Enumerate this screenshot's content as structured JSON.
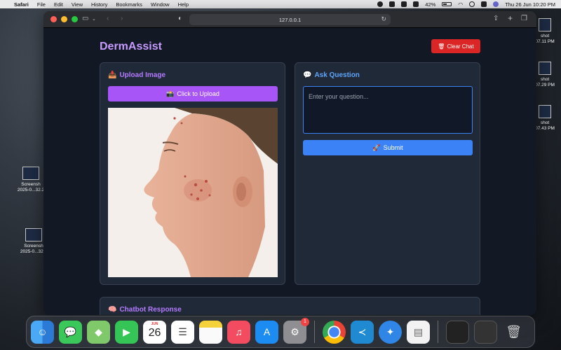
{
  "menubar": {
    "app_name": "Safari",
    "items": [
      "File",
      "Edit",
      "View",
      "History",
      "Bookmarks",
      "Window",
      "Help"
    ],
    "battery": "42%",
    "datetime": "Thu 26 Jun  10:20 PM"
  },
  "desktop": {
    "files": [
      {
        "line1": "Screensh",
        "line2": "2025-0...32.2"
      },
      {
        "line1": "Screensh",
        "line2": "2025-0...32.3"
      },
      {
        "line1": "shot",
        "line2": "07.11 PM"
      },
      {
        "line1": "shot",
        "line2": "07.29 PM"
      },
      {
        "line1": "shot",
        "line2": "07.43 PM"
      }
    ]
  },
  "browser": {
    "url": "127.0.0.1"
  },
  "app": {
    "title": "DermAssist",
    "clear_chat": {
      "icon": "🗑",
      "label": "Clear Chat"
    },
    "upload": {
      "title_icon": "📥",
      "title": "Upload Image",
      "button_icon": "📸",
      "button_label": "Click to Upload"
    },
    "ask": {
      "title_icon": "💬",
      "title": "Ask Question",
      "placeholder": "Enter your question...",
      "submit_icon": "🚀",
      "submit_label": "Submit"
    },
    "response": {
      "title_icon": "🧠",
      "title": "Chatbot Response"
    }
  },
  "dock": {
    "calendar_month": "JUN",
    "calendar_day": "26",
    "settings_badge": "1"
  },
  "colors": {
    "app_bg": "#121824",
    "card_bg": "#1f2937",
    "accent_purple": "#a855f7",
    "accent_blue": "#3b82f6",
    "danger": "#dc2626",
    "title_purple": "#c89bff"
  }
}
